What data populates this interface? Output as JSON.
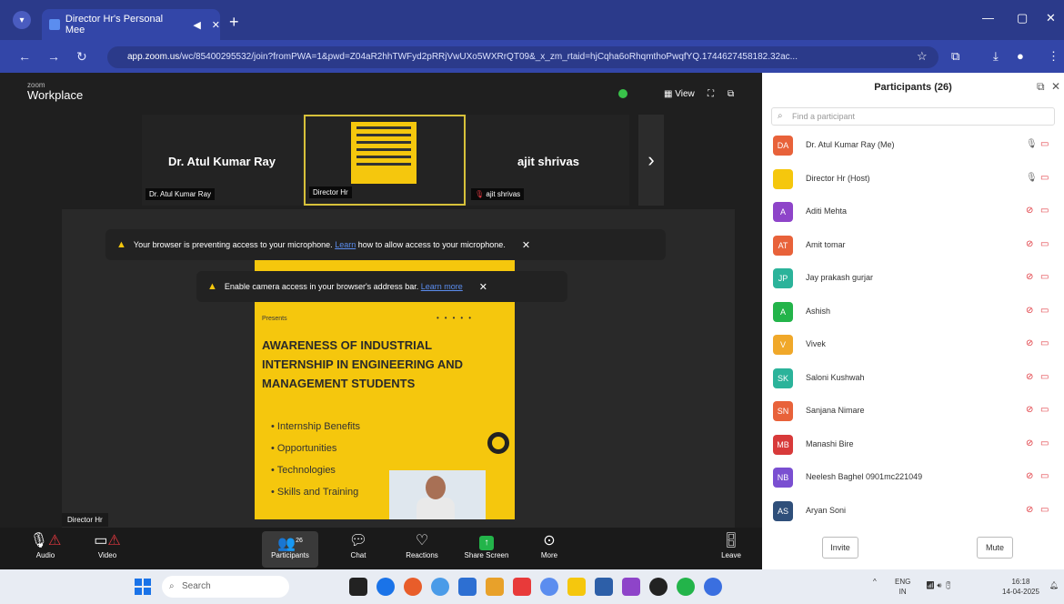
{
  "browser": {
    "tab_title": "Director Hr's Personal Mee",
    "url_host": "app.zoom.us",
    "url_rest": "/wc/85400295532/join?fromPWA=1&pwd=Z04aR2hhTWFyd2pRRjVwUXo5WXRrQT09&_x_zm_rtaid=hjCqha6oRhqmthoPwqfYQ.1744627458182.32ac..."
  },
  "zoom": {
    "brand_small": "zoom",
    "brand_big": "Workplace",
    "view_label": "View",
    "gallery": [
      {
        "name": "Dr. Atul Kumar Ray",
        "label": "Dr. Atul Kumar Ray"
      },
      {
        "name": "",
        "label": "Director Hr"
      },
      {
        "name": "ajit shrivas",
        "label": "ajit shrivas"
      }
    ],
    "alert_mic": {
      "text": "Your browser is preventing access to your microphone.",
      "link": "Learn",
      "rest": "how to allow access to your microphone."
    },
    "alert_cam": {
      "text": "Enable camera access in your browser's address bar.",
      "link": "Learn more"
    },
    "self_label": "Director Hr",
    "slide": {
      "presents": "Presents",
      "title": "AWARENESS OF INDUSTRIAL INTERNSHIP IN ENGINEERING AND MANAGEMENT STUDENTS",
      "bullets": [
        "Internship Benefits",
        "Opportunities",
        "Technologies",
        "Skills and Training"
      ]
    },
    "toolbar": {
      "audio": "Audio",
      "video": "Video",
      "participants": "Participants",
      "participants_count": "26",
      "chat": "Chat",
      "reactions": "Reactions",
      "share": "Share Screen",
      "more": "More",
      "leave": "Leave"
    }
  },
  "panel": {
    "title": "Participants (26)",
    "search_placeholder": "Find a participant",
    "invite": "Invite",
    "mute": "Mute",
    "participants": [
      {
        "initials": "DA",
        "name": "Dr. Atul Kumar Ray (Me)",
        "color": "#e8623a"
      },
      {
        "initials": "",
        "name": "Director Hr (Host)",
        "color": "#f5c70d"
      },
      {
        "initials": "A",
        "name": "Aditi Mehta",
        "color": "#8e44c9"
      },
      {
        "initials": "AT",
        "name": "Amit tomar",
        "color": "#e8623a"
      },
      {
        "initials": "JP",
        "name": "Jay prakash gurjar",
        "color": "#2bb39a"
      },
      {
        "initials": "A",
        "name": "Ashish",
        "color": "#23b44a"
      },
      {
        "initials": "V",
        "name": "Vivek",
        "color": "#f0a82a"
      },
      {
        "initials": "SK",
        "name": "Saloni Kushwah",
        "color": "#2bb39a"
      },
      {
        "initials": "SN",
        "name": "Sanjana Nimare",
        "color": "#e8623a"
      },
      {
        "initials": "MB",
        "name": "Manashi Bire",
        "color": "#d83a3a"
      },
      {
        "initials": "NB",
        "name": "Neelesh Baghel 0901mc221049",
        "color": "#7a4fd1"
      },
      {
        "initials": "AS",
        "name": "Aryan Soni",
        "color": "#2f4f7a"
      }
    ]
  },
  "taskbar": {
    "search": "Search",
    "lang": "ENG",
    "region": "IN",
    "time": "16:18",
    "date": "14-04-2025"
  }
}
